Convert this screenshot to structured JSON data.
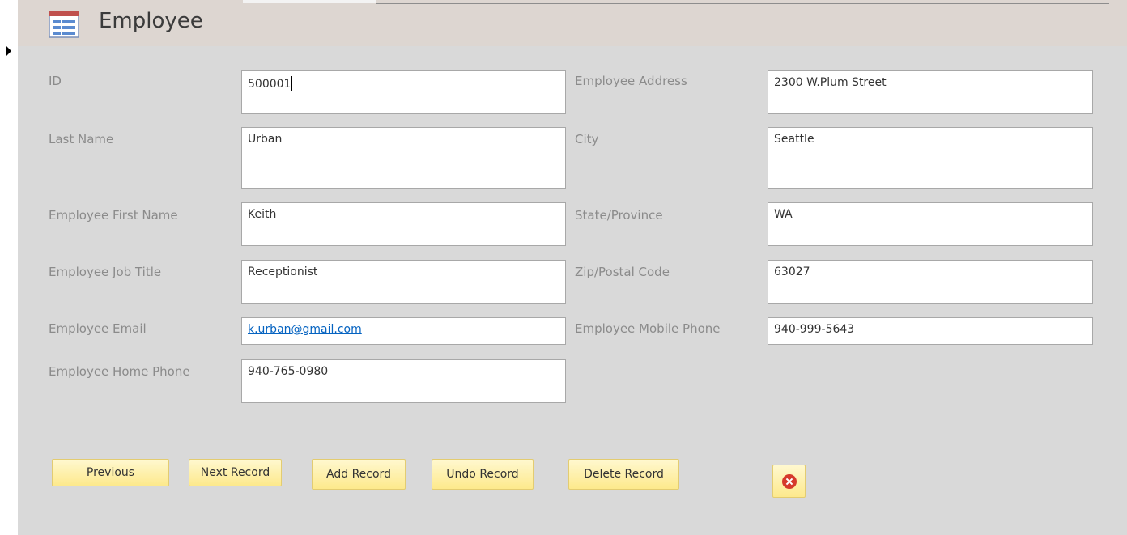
{
  "form": {
    "title": "Employee"
  },
  "fields": {
    "id": {
      "label": "ID",
      "value": "500001"
    },
    "last_name": {
      "label": "Last Name",
      "value": "Urban"
    },
    "first_name": {
      "label": "Employee First Name",
      "value": "Keith"
    },
    "job_title": {
      "label": "Employee Job Title",
      "value": "Receptionist"
    },
    "email": {
      "label": "Employee Email",
      "value": "k.urban@gmail.com"
    },
    "home_phone": {
      "label": "Employee Home Phone",
      "value": "940-765-0980"
    },
    "address": {
      "label": "Employee Address",
      "value": "2300 W.Plum Street"
    },
    "city": {
      "label": "City",
      "value": "Seattle"
    },
    "state": {
      "label": "State/Province",
      "value": "WA"
    },
    "zip": {
      "label": "Zip/Postal Code",
      "value": "63027"
    },
    "mobile_phone": {
      "label": "Employee Mobile Phone",
      "value": "940-999-5643"
    }
  },
  "buttons": {
    "previous": "Previous",
    "next": "Next Record",
    "add": "Add Record",
    "undo": "Undo Record",
    "delete": "Delete Record",
    "close_icon": "close-icon"
  },
  "colors": {
    "header_bg": "#ddd6d1",
    "detail_bg": "#d9d9d9",
    "button_bg": "#fef3b0",
    "link": "#0563c1",
    "close_red": "#d6392c"
  }
}
